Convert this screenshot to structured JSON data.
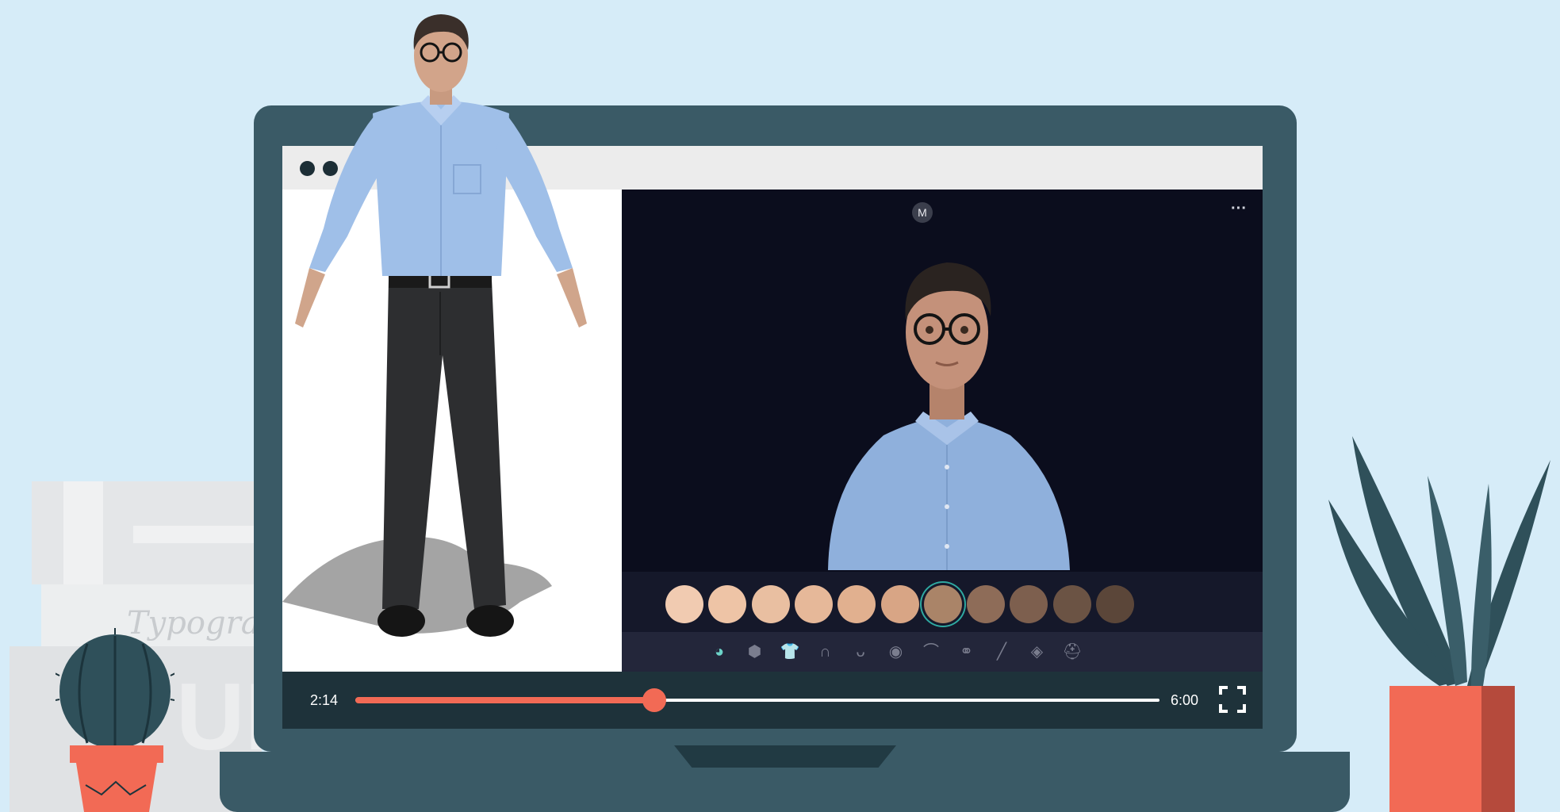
{
  "background": {
    "book_title": "Typogra",
    "book_letters": "ULO"
  },
  "browser": {
    "window_controls": [
      "close",
      "minimize",
      "maximize"
    ]
  },
  "editor": {
    "user_initial": "M",
    "more_label": "···",
    "selected_swatch_index": 6,
    "skin_tones": [
      "#f1cbb1",
      "#eec4a6",
      "#e9bfa1",
      "#e6b899",
      "#e1b08f",
      "#d8a585",
      "#aa8468",
      "#8e6c58",
      "#7d5f4e",
      "#6b5344",
      "#5b4639"
    ],
    "categories": [
      {
        "icon": "skin-tone-icon",
        "glyph": "◕"
      },
      {
        "icon": "shapes-icon",
        "glyph": "⬢"
      },
      {
        "icon": "shirt-icon",
        "glyph": "👕"
      },
      {
        "icon": "hair-icon",
        "glyph": "∩"
      },
      {
        "icon": "beard-icon",
        "glyph": "ᴗ"
      },
      {
        "icon": "eye-icon",
        "glyph": "◉"
      },
      {
        "icon": "eyebrow-icon",
        "glyph": "⌒"
      },
      {
        "icon": "glasses-icon",
        "glyph": "⚭"
      },
      {
        "icon": "brush-icon",
        "glyph": "╱"
      },
      {
        "icon": "mask-icon",
        "glyph": "◈"
      },
      {
        "icon": "hat-icon",
        "glyph": "⛑"
      }
    ]
  },
  "player": {
    "current_time": "2:14",
    "total_time": "6:00",
    "progress_fraction": 0.372
  }
}
